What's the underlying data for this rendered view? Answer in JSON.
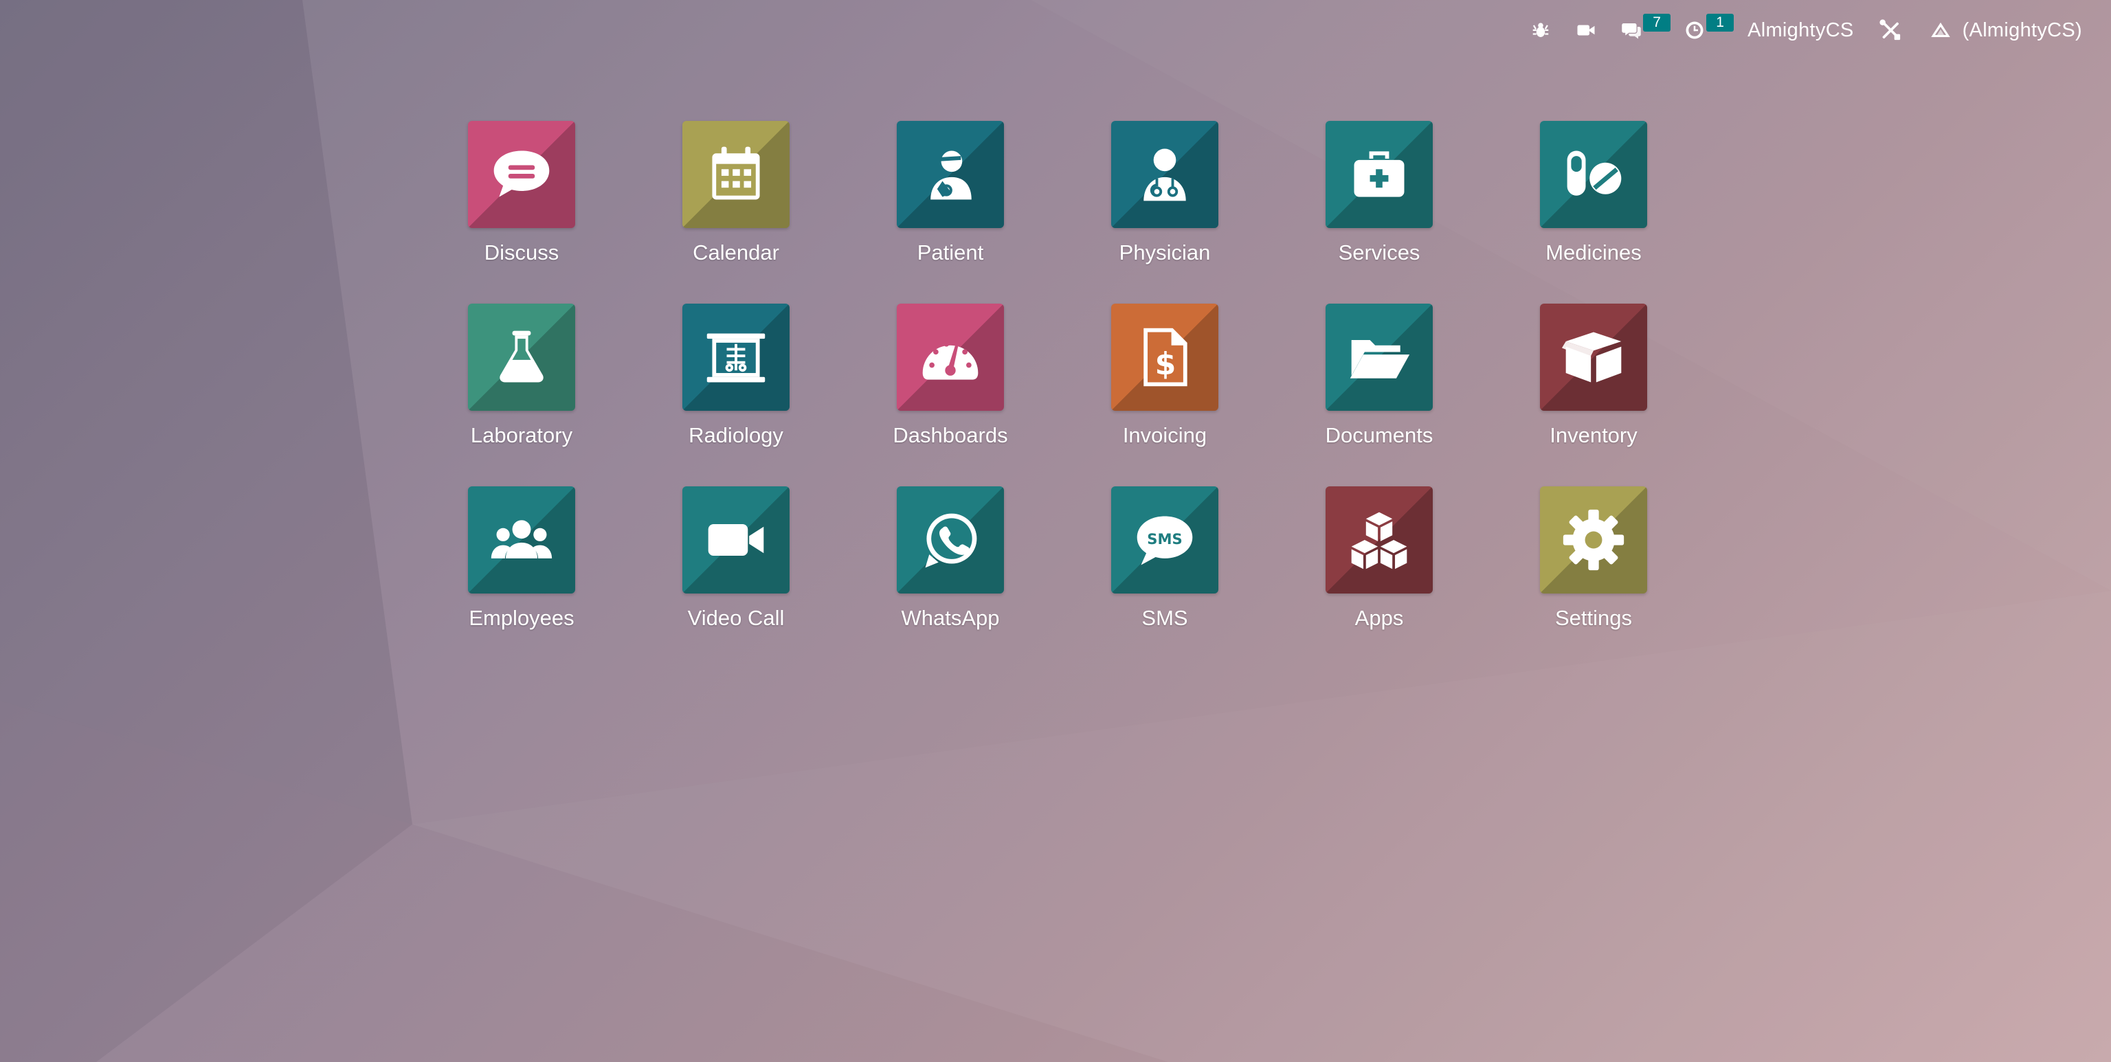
{
  "topbar": {
    "discuss_badge": "7",
    "activity_badge": "1",
    "database": "AlmightyCS",
    "company": "(AlmightyCS)"
  },
  "apps": [
    {
      "label": "Discuss",
      "icon": "chat-bubble-icon",
      "color": "#c94e79"
    },
    {
      "label": "Calendar",
      "icon": "calendar-icon",
      "color": "#a9a153"
    },
    {
      "label": "Patient",
      "icon": "patient-icon",
      "color": "#1a6f7f"
    },
    {
      "label": "Physician",
      "icon": "physician-icon",
      "color": "#1a6f7f"
    },
    {
      "label": "Services",
      "icon": "medical-kit-icon",
      "color": "#1f7d80"
    },
    {
      "label": "Medicines",
      "icon": "pills-icon",
      "color": "#1f7d80"
    },
    {
      "label": "Laboratory",
      "icon": "flask-icon",
      "color": "#3d937d"
    },
    {
      "label": "Radiology",
      "icon": "x-ray-icon",
      "color": "#1a6f7f"
    },
    {
      "label": "Dashboards",
      "icon": "speedometer-icon",
      "color": "#c94e79"
    },
    {
      "label": "Invoicing",
      "icon": "invoice-icon",
      "color": "#cc6c37"
    },
    {
      "label": "Documents",
      "icon": "folder-open-icon",
      "color": "#1f7d80"
    },
    {
      "label": "Inventory",
      "icon": "box-icon",
      "color": "#8b3c42"
    },
    {
      "label": "Employees",
      "icon": "users-icon",
      "color": "#1f7d80"
    },
    {
      "label": "Video Call",
      "icon": "video-camera-icon",
      "color": "#1f7d80"
    },
    {
      "label": "WhatsApp",
      "icon": "whatsapp-icon",
      "color": "#1f7d80"
    },
    {
      "label": "SMS",
      "icon": "sms-bubble-icon",
      "color": "#1f7d80"
    },
    {
      "label": "Apps",
      "icon": "cubes-icon",
      "color": "#8b3c42"
    },
    {
      "label": "Settings",
      "icon": "gear-icon",
      "color": "#a9a153"
    }
  ]
}
